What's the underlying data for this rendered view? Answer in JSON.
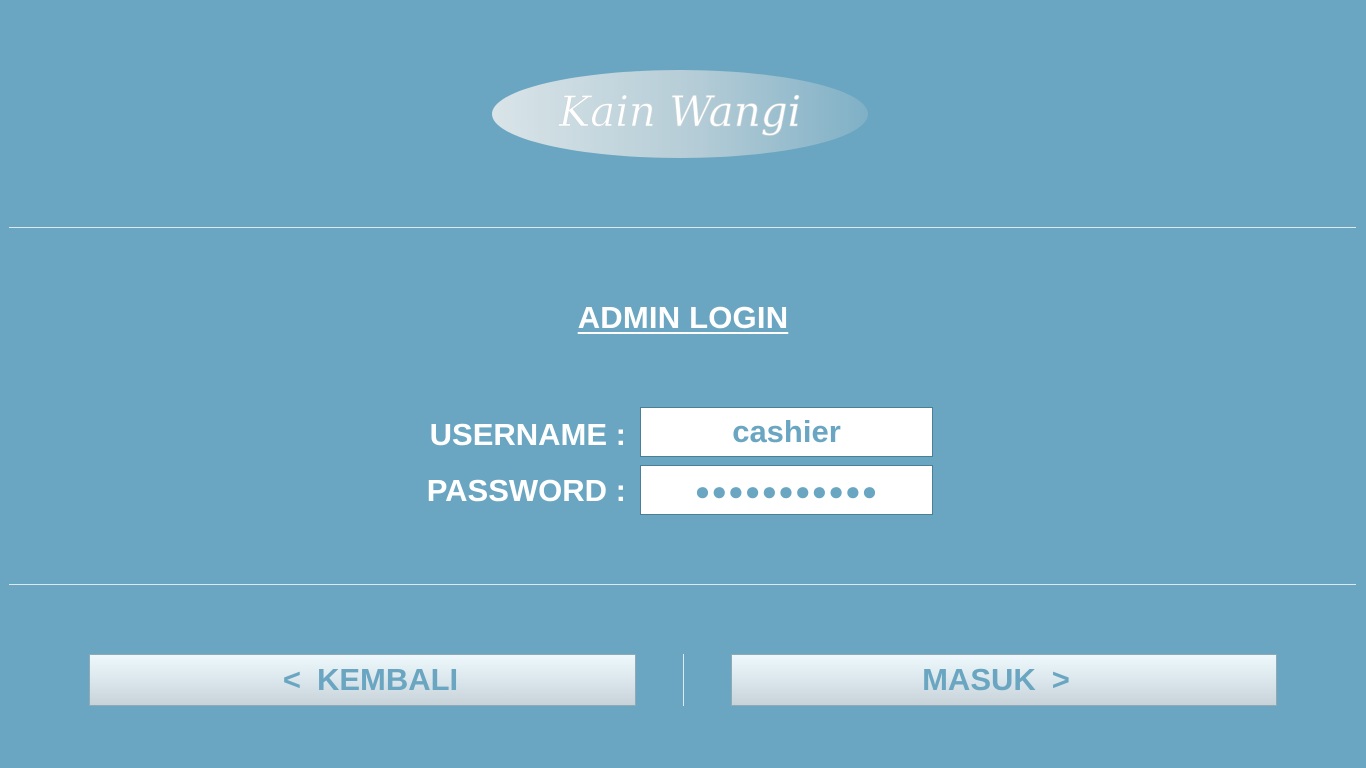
{
  "brand": {
    "logo_text": "Kain Wangi"
  },
  "login": {
    "title": "ADMIN LOGIN",
    "username_label": "USERNAME :",
    "username_value": "cashier",
    "password_label": "PASSWORD :",
    "password_masked": "●●●●●●●●●●●"
  },
  "buttons": {
    "back_arrow": "<",
    "back_label": "KEMBALI",
    "login_label": "MASUK",
    "login_arrow": ">"
  },
  "colors": {
    "background": "#6aa6c1",
    "text_white": "#ffffff",
    "input_text": "#6aa6c1"
  }
}
